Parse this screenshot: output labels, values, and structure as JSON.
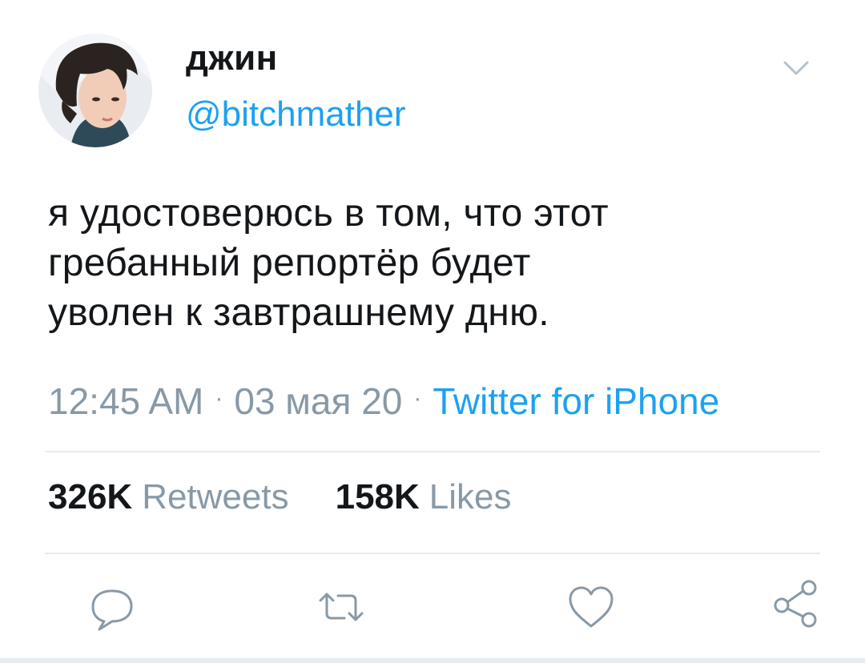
{
  "tweet": {
    "display_name": "джин",
    "handle": "@bitchmather",
    "text": "я удостоверюсь в том, что этот\nгребанный репортёр будет\nуволен к завтрашнему дню.",
    "time": "12:45 AM",
    "separator": "·",
    "date": "03 мая 20",
    "client": "Twitter for iPhone"
  },
  "stats": {
    "retweets_count": "326K",
    "retweets_label": "Retweets",
    "likes_count": "158K",
    "likes_label": "Likes"
  },
  "icons": {
    "menu": "chevron-down-icon",
    "reply": "reply-icon",
    "retweet": "retweet-icon",
    "like": "heart-icon",
    "share": "share-icon"
  },
  "colors": {
    "accent": "#1da1f2",
    "text": "#14171a",
    "muted": "#8899a6",
    "border": "#e6ecf0"
  }
}
